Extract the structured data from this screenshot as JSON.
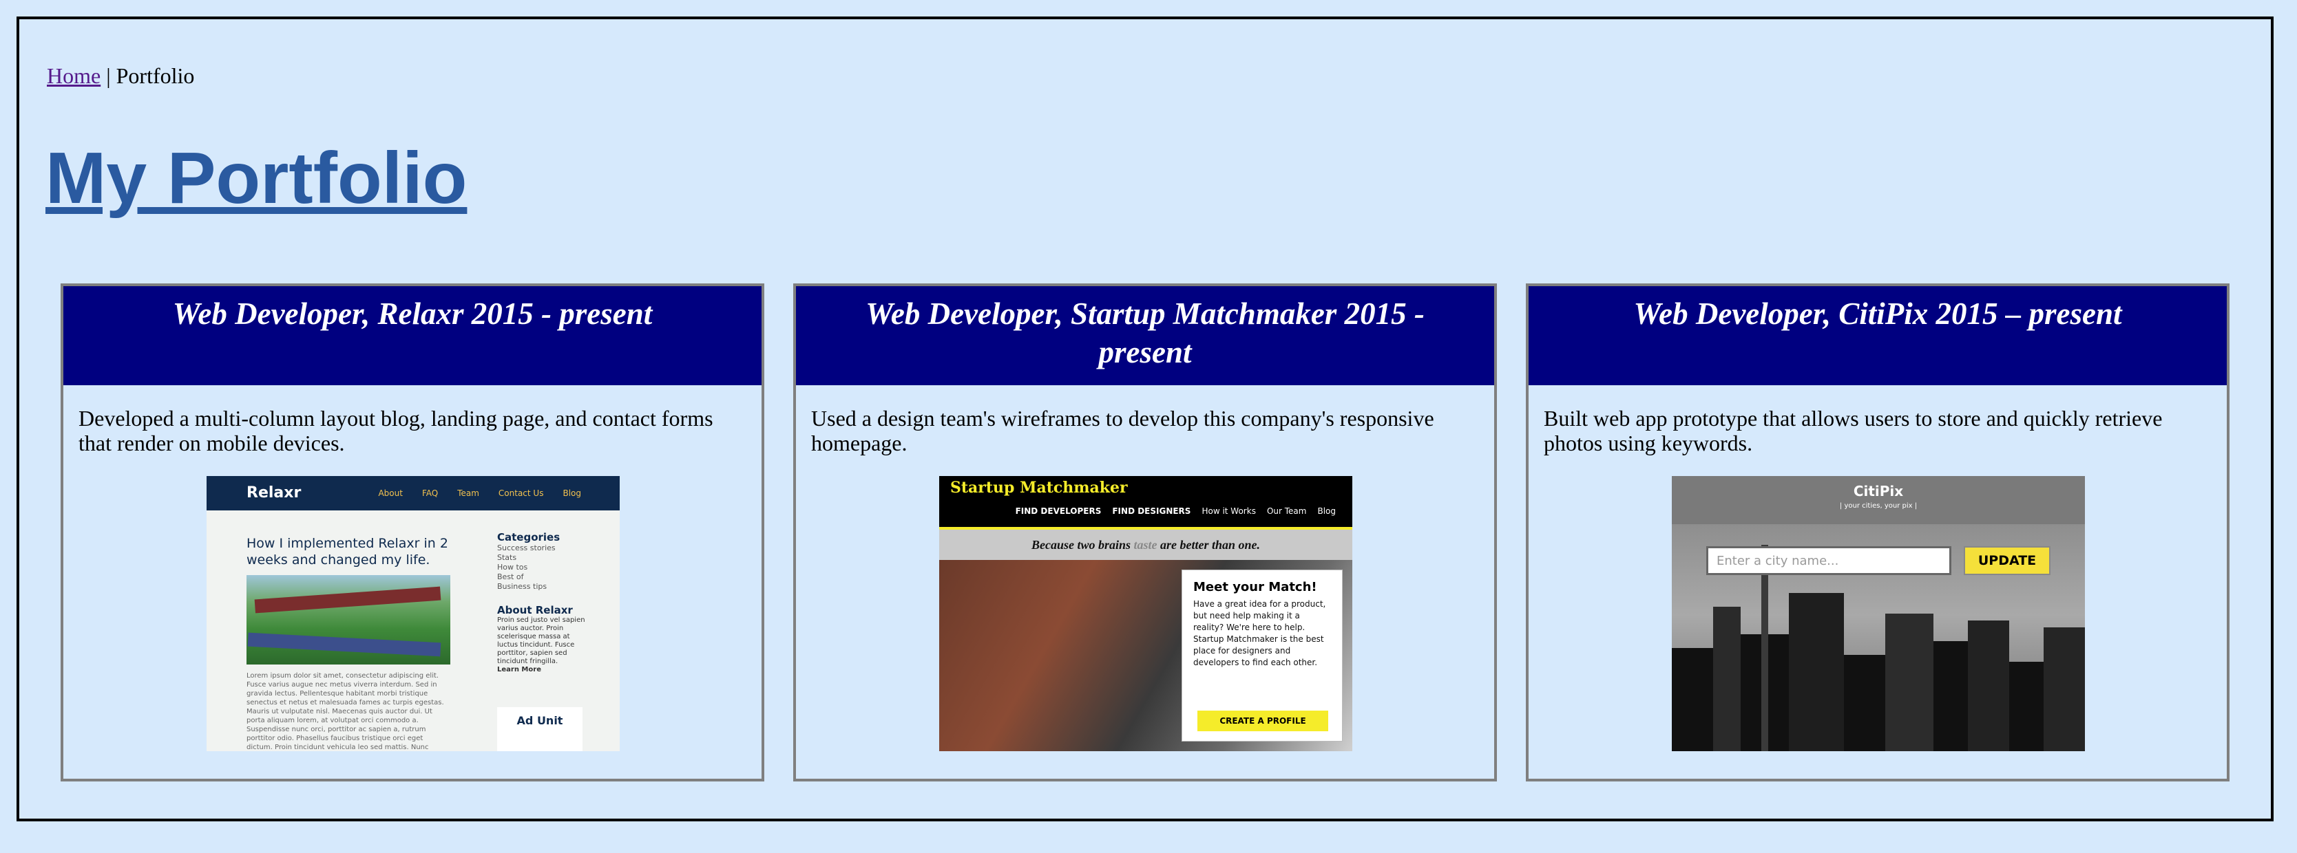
{
  "breadcrumb": {
    "home": "Home",
    "separator": "|",
    "current": "Portfolio"
  },
  "page_title": "My Portfolio",
  "cards": [
    {
      "title": "Web Developer, Relaxr 2015 - present",
      "description": "Developed a multi-column layout blog, landing page, and contact forms that render on mobile devices.",
      "preview": {
        "logo": "Relaxr",
        "nav": [
          "About",
          "FAQ",
          "Team",
          "Contact Us",
          "Blog"
        ],
        "headline": "How I implemented Relaxr in 2 weeks and changed my life.",
        "body": "Lorem ipsum dolor sit amet, consectetur adipiscing elit. Fusce varius augue nec metus viverra interdum. Sed in gravida lectus. Pellentesque habitant morbi tristique senectus et netus et malesuada fames ac turpis egestas. Mauris ut vulputate nisl. Maecenas quis auctor dui. Ut porta aliquam lorem, at volutpat orci commodo a. Suspendisse nunc orci, porttitor ac sapien a, rutrum porttitor odio. Phasellus faucibus tristique orci eget dictum. Proin tincidunt vehicula leo sed mattis. Nunc faucibus augue a",
        "categories_title": "Categories",
        "categories": [
          "Success stories",
          "Stats",
          "How tos",
          "Best of",
          "Business tips"
        ],
        "about_title": "About Relaxr",
        "about_text": "Proin sed justo vel sapien varius auctor. Proin scelerisque massa at luctus tincidunt. Fusce porttitor, sapien sed tincidunt fringilla.",
        "learn_more": "Learn More",
        "ad": "Ad Unit"
      }
    },
    {
      "title": "Web Developer, Startup Matchmaker 2015 - present",
      "description": "Used a design team's wireframes to develop this company's responsive homepage.",
      "preview": {
        "logo": "Startup Matchmaker",
        "nav": [
          "FIND DEVELOPERS",
          "FIND DESIGNERS",
          "How it Works",
          "Our Team",
          "Blog"
        ],
        "tagline_pre": "Because two brains",
        "tagline_strike": "taste",
        "tagline_post": "are better than one.",
        "card_title": "Meet your Match!",
        "card_body": "Have a great idea for a product, but need help making it a reality? We're here to help. Startup Matchmaker is the best place for designers and developers to find each other.",
        "cta": "CREATE A PROFILE"
      }
    },
    {
      "title": "Web Developer, CitiPix 2015 – present",
      "description": "Built web app prototype that allows users to store and quickly retrieve photos using keywords.",
      "preview": {
        "logo": "CitiPix",
        "subtitle": "| your cities, your pix |",
        "input_placeholder": "Enter a city name...",
        "button": "UPDATE"
      }
    }
  ]
}
